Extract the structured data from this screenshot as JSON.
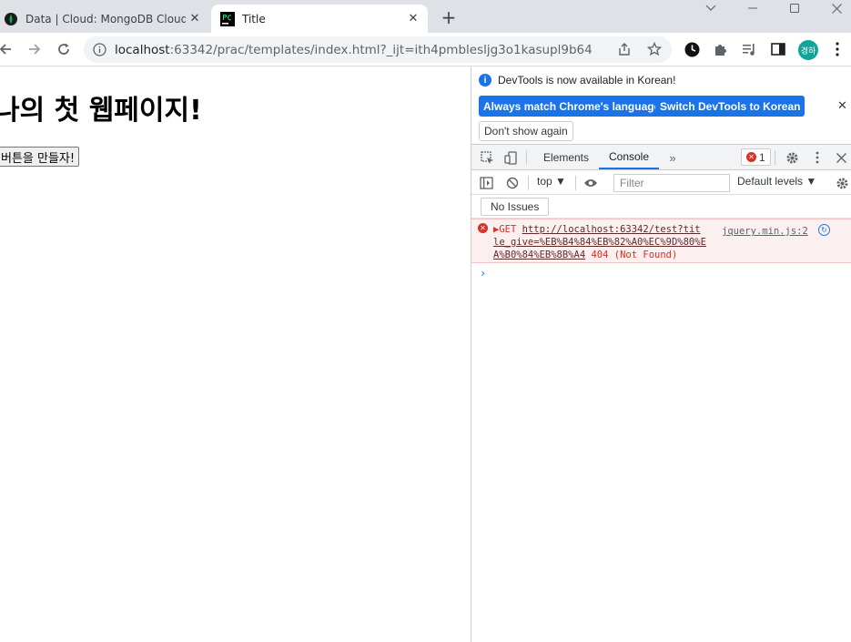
{
  "browser": {
    "tabs": [
      {
        "title": "Data | Cloud: MongoDB Cloud",
        "active": false,
        "favicon": "mongodb-leaf-icon"
      },
      {
        "title": "Title",
        "active": true,
        "favicon": "pycharm-icon"
      }
    ],
    "new_tab_label": "+",
    "address": {
      "host": "localhost",
      "rest": ":63342/prac/templates/index.html?_ijt=ith4pmblesljg3o1kasupl9b64"
    },
    "profile_initials": "경하"
  },
  "page": {
    "heading": "나의 첫 웹페이지!",
    "button_label": "버튼을 만들자!"
  },
  "devtools": {
    "info_message": "DevTools is now available in Korean!",
    "always_match_label": "Always match Chrome's language",
    "switch_label": "Switch DevTools to Korean",
    "dont_show_label": "Don't show again",
    "tabs": [
      "Elements",
      "Console"
    ],
    "active_tab": "Console",
    "error_count": "1",
    "context": "top",
    "filter_placeholder": "Filter",
    "levels": "Default levels",
    "issues_label": "No Issues",
    "console_entries": [
      {
        "method": "GET",
        "url_lines": [
          "http://localhost:63342/test?tit",
          "le_give=%EB%B4%84%EB%82%A0%EC%9D%80%E",
          "A%B0%84%EB%8B%A4"
        ],
        "status": "404 (Not Found)",
        "source": "jquery.min.js:2"
      }
    ]
  },
  "colors": {
    "accent": "#1a73e8",
    "error": "#d93025",
    "error_bg": "#fcefef"
  }
}
